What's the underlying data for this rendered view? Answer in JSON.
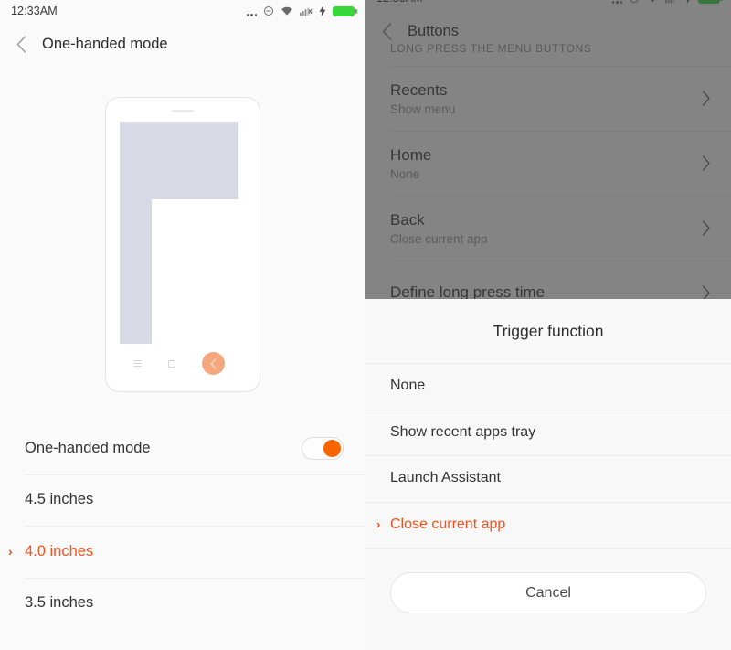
{
  "left_panel": {
    "status_bar": {
      "time": "12:33AM",
      "icons": [
        "more-dots-icon",
        "dnd-icon",
        "wifi-icon",
        "signal-bars-icon",
        "charging-bolt-icon",
        "battery-icon"
      ]
    },
    "header": {
      "back_icon": "back-chevron-icon",
      "title": "One-handed mode"
    },
    "illustration": {
      "name": "one-handed-mode-phone-preview",
      "nav_icons": [
        "menu-icon",
        "square-icon",
        "back-chevron-icon"
      ]
    },
    "rows": [
      {
        "label": "One-handed mode",
        "type": "toggle",
        "value": "on",
        "selected": false
      },
      {
        "label": "4.5 inches",
        "type": "option",
        "selected": false
      },
      {
        "label": "4.0 inches",
        "type": "option",
        "selected": true
      },
      {
        "label": "3.5 inches",
        "type": "option",
        "selected": false
      }
    ],
    "selection_marker": "›"
  },
  "right_panel": {
    "header": {
      "back_icon": "back-chevron-icon",
      "title": "Buttons"
    },
    "section_header": "Long press the menu buttons",
    "rows": [
      {
        "title": "Recents",
        "subtitle": "Show menu",
        "chevron": "›"
      },
      {
        "title": "Home",
        "subtitle": "None",
        "chevron": "›"
      },
      {
        "title": "Back",
        "subtitle": "Close current app",
        "chevron": "›"
      },
      {
        "title": "Define long press time",
        "subtitle": "",
        "chevron": "›"
      }
    ]
  },
  "dialog": {
    "title": "Trigger function",
    "options": [
      {
        "label": "None",
        "selected": false
      },
      {
        "label": "Show recent apps tray",
        "selected": false
      },
      {
        "label": "Launch Assistant",
        "selected": false
      },
      {
        "label": "Close current app",
        "selected": true
      }
    ],
    "selection_marker": "›",
    "cancel_label": "Cancel"
  },
  "colors": {
    "accent_orange": "#f4511e",
    "toggle_on": "#fa6400",
    "battery_green": "#37d63a",
    "phone_circle": "#f5a87e",
    "panel_bg": "#fafafa"
  }
}
